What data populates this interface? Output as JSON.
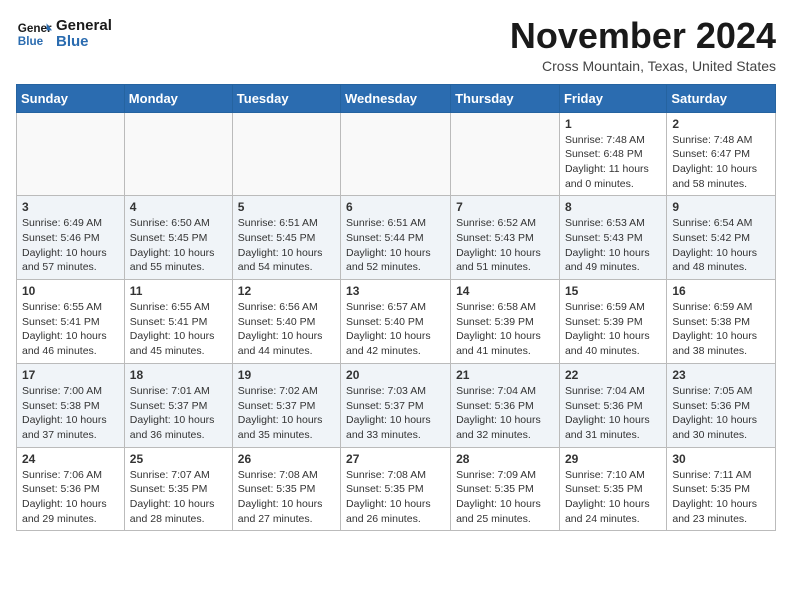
{
  "header": {
    "logo_line1": "General",
    "logo_line2": "Blue",
    "month_title": "November 2024",
    "location": "Cross Mountain, Texas, United States"
  },
  "weekdays": [
    "Sunday",
    "Monday",
    "Tuesday",
    "Wednesday",
    "Thursday",
    "Friday",
    "Saturday"
  ],
  "weeks": [
    [
      {
        "day": "",
        "info": ""
      },
      {
        "day": "",
        "info": ""
      },
      {
        "day": "",
        "info": ""
      },
      {
        "day": "",
        "info": ""
      },
      {
        "day": "",
        "info": ""
      },
      {
        "day": "1",
        "info": "Sunrise: 7:48 AM\nSunset: 6:48 PM\nDaylight: 11 hours\nand 0 minutes."
      },
      {
        "day": "2",
        "info": "Sunrise: 7:48 AM\nSunset: 6:47 PM\nDaylight: 10 hours\nand 58 minutes."
      }
    ],
    [
      {
        "day": "3",
        "info": "Sunrise: 6:49 AM\nSunset: 5:46 PM\nDaylight: 10 hours\nand 57 minutes."
      },
      {
        "day": "4",
        "info": "Sunrise: 6:50 AM\nSunset: 5:45 PM\nDaylight: 10 hours\nand 55 minutes."
      },
      {
        "day": "5",
        "info": "Sunrise: 6:51 AM\nSunset: 5:45 PM\nDaylight: 10 hours\nand 54 minutes."
      },
      {
        "day": "6",
        "info": "Sunrise: 6:51 AM\nSunset: 5:44 PM\nDaylight: 10 hours\nand 52 minutes."
      },
      {
        "day": "7",
        "info": "Sunrise: 6:52 AM\nSunset: 5:43 PM\nDaylight: 10 hours\nand 51 minutes."
      },
      {
        "day": "8",
        "info": "Sunrise: 6:53 AM\nSunset: 5:43 PM\nDaylight: 10 hours\nand 49 minutes."
      },
      {
        "day": "9",
        "info": "Sunrise: 6:54 AM\nSunset: 5:42 PM\nDaylight: 10 hours\nand 48 minutes."
      }
    ],
    [
      {
        "day": "10",
        "info": "Sunrise: 6:55 AM\nSunset: 5:41 PM\nDaylight: 10 hours\nand 46 minutes."
      },
      {
        "day": "11",
        "info": "Sunrise: 6:55 AM\nSunset: 5:41 PM\nDaylight: 10 hours\nand 45 minutes."
      },
      {
        "day": "12",
        "info": "Sunrise: 6:56 AM\nSunset: 5:40 PM\nDaylight: 10 hours\nand 44 minutes."
      },
      {
        "day": "13",
        "info": "Sunrise: 6:57 AM\nSunset: 5:40 PM\nDaylight: 10 hours\nand 42 minutes."
      },
      {
        "day": "14",
        "info": "Sunrise: 6:58 AM\nSunset: 5:39 PM\nDaylight: 10 hours\nand 41 minutes."
      },
      {
        "day": "15",
        "info": "Sunrise: 6:59 AM\nSunset: 5:39 PM\nDaylight: 10 hours\nand 40 minutes."
      },
      {
        "day": "16",
        "info": "Sunrise: 6:59 AM\nSunset: 5:38 PM\nDaylight: 10 hours\nand 38 minutes."
      }
    ],
    [
      {
        "day": "17",
        "info": "Sunrise: 7:00 AM\nSunset: 5:38 PM\nDaylight: 10 hours\nand 37 minutes."
      },
      {
        "day": "18",
        "info": "Sunrise: 7:01 AM\nSunset: 5:37 PM\nDaylight: 10 hours\nand 36 minutes."
      },
      {
        "day": "19",
        "info": "Sunrise: 7:02 AM\nSunset: 5:37 PM\nDaylight: 10 hours\nand 35 minutes."
      },
      {
        "day": "20",
        "info": "Sunrise: 7:03 AM\nSunset: 5:37 PM\nDaylight: 10 hours\nand 33 minutes."
      },
      {
        "day": "21",
        "info": "Sunrise: 7:04 AM\nSunset: 5:36 PM\nDaylight: 10 hours\nand 32 minutes."
      },
      {
        "day": "22",
        "info": "Sunrise: 7:04 AM\nSunset: 5:36 PM\nDaylight: 10 hours\nand 31 minutes."
      },
      {
        "day": "23",
        "info": "Sunrise: 7:05 AM\nSunset: 5:36 PM\nDaylight: 10 hours\nand 30 minutes."
      }
    ],
    [
      {
        "day": "24",
        "info": "Sunrise: 7:06 AM\nSunset: 5:36 PM\nDaylight: 10 hours\nand 29 minutes."
      },
      {
        "day": "25",
        "info": "Sunrise: 7:07 AM\nSunset: 5:35 PM\nDaylight: 10 hours\nand 28 minutes."
      },
      {
        "day": "26",
        "info": "Sunrise: 7:08 AM\nSunset: 5:35 PM\nDaylight: 10 hours\nand 27 minutes."
      },
      {
        "day": "27",
        "info": "Sunrise: 7:08 AM\nSunset: 5:35 PM\nDaylight: 10 hours\nand 26 minutes."
      },
      {
        "day": "28",
        "info": "Sunrise: 7:09 AM\nSunset: 5:35 PM\nDaylight: 10 hours\nand 25 minutes."
      },
      {
        "day": "29",
        "info": "Sunrise: 7:10 AM\nSunset: 5:35 PM\nDaylight: 10 hours\nand 24 minutes."
      },
      {
        "day": "30",
        "info": "Sunrise: 7:11 AM\nSunset: 5:35 PM\nDaylight: 10 hours\nand 23 minutes."
      }
    ]
  ]
}
